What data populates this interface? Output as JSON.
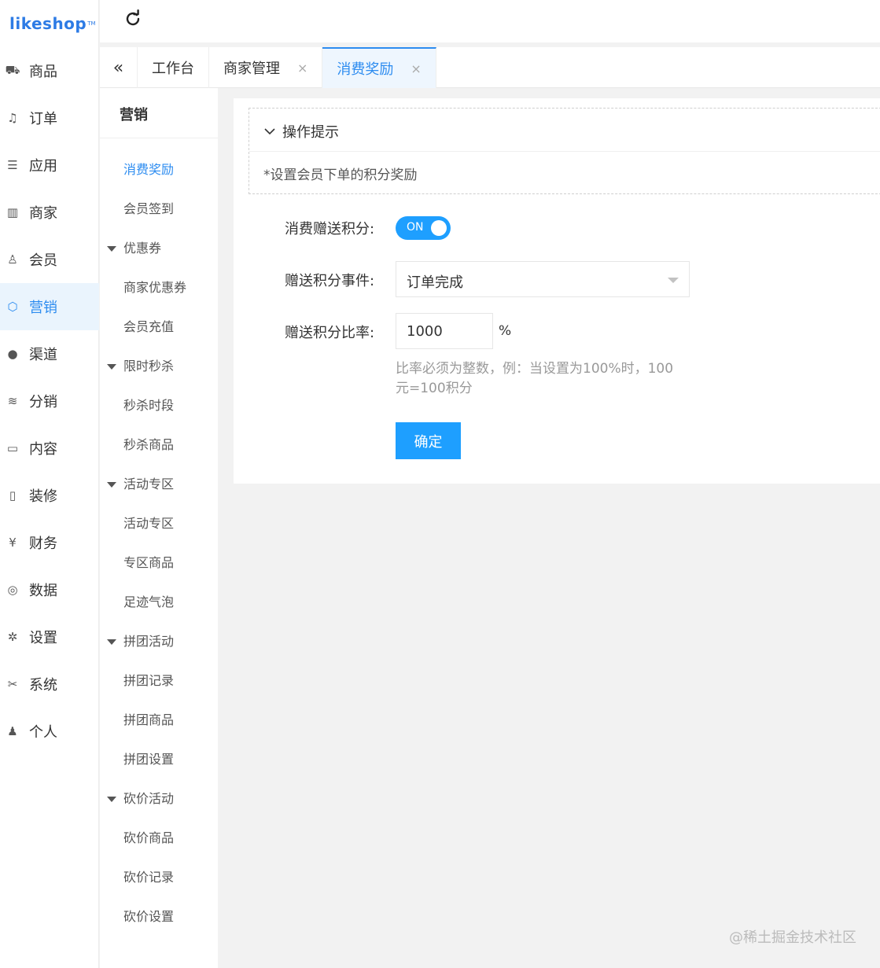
{
  "brand": {
    "name": "likeshop",
    "tm": "TM",
    "color": "#2d7be5"
  },
  "nav": {
    "items": [
      {
        "label": "商品",
        "icon": "cart-icon"
      },
      {
        "label": "订单",
        "icon": "bell-icon"
      },
      {
        "label": "应用",
        "icon": "list-icon"
      },
      {
        "label": "商家",
        "icon": "store-icon"
      },
      {
        "label": "会员",
        "icon": "user-icon"
      },
      {
        "label": "营销",
        "icon": "cube-icon",
        "active": true
      },
      {
        "label": "渠道",
        "icon": "wechat-icon"
      },
      {
        "label": "分销",
        "icon": "layers-icon"
      },
      {
        "label": "内容",
        "icon": "book-icon"
      },
      {
        "label": "装修",
        "icon": "tablet-icon"
      },
      {
        "label": "财务",
        "icon": "yen-icon"
      },
      {
        "label": "数据",
        "icon": "globe-icon"
      },
      {
        "label": "设置",
        "icon": "gear-icon"
      },
      {
        "label": "系统",
        "icon": "tools-icon"
      },
      {
        "label": "个人",
        "icon": "person-icon"
      }
    ]
  },
  "tabs": [
    {
      "label": "工作台",
      "closable": false
    },
    {
      "label": "商家管理",
      "closable": true
    },
    {
      "label": "消费奖励",
      "closable": true,
      "active": true
    }
  ],
  "submenu": {
    "title": "营销",
    "entries": [
      {
        "type": "item",
        "label": "消费奖励",
        "active": true
      },
      {
        "type": "item",
        "label": "会员签到"
      },
      {
        "type": "group",
        "label": "优惠券"
      },
      {
        "type": "item",
        "label": "商家优惠券"
      },
      {
        "type": "item",
        "label": "会员充值"
      },
      {
        "type": "group",
        "label": "限时秒杀"
      },
      {
        "type": "item",
        "label": "秒杀时段"
      },
      {
        "type": "item",
        "label": "秒杀商品"
      },
      {
        "type": "group",
        "label": "活动专区"
      },
      {
        "type": "item",
        "label": "活动专区"
      },
      {
        "type": "item",
        "label": "专区商品"
      },
      {
        "type": "item",
        "label": "足迹气泡"
      },
      {
        "type": "group",
        "label": "拼团活动"
      },
      {
        "type": "item",
        "label": "拼团记录"
      },
      {
        "type": "item",
        "label": "拼团商品"
      },
      {
        "type": "item",
        "label": "拼团设置"
      },
      {
        "type": "group",
        "label": "砍价活动"
      },
      {
        "type": "item",
        "label": "砍价商品"
      },
      {
        "type": "item",
        "label": "砍价记录"
      },
      {
        "type": "item",
        "label": "砍价设置"
      }
    ]
  },
  "tips": {
    "title": "操作提示",
    "text": "*设置会员下单的积分奖励"
  },
  "form": {
    "switch_label": "消费赠送积分:",
    "switch_text": "ON",
    "switch_on": true,
    "event_label": "赠送积分事件:",
    "event_value": "订单完成",
    "rate_label": "赠送积分比率:",
    "rate_value": "1000",
    "rate_unit": "%",
    "hint_line1": "比率必须为整数，例：当设置为100%时，100",
    "hint_line2": "元=100积分",
    "submit_label": "确定"
  },
  "watermark": "@稀土掘金技术社区",
  "colors": {
    "accent": "#2d8cf0",
    "button": "#1e9fff",
    "active_bg": "#eaf4fd"
  }
}
